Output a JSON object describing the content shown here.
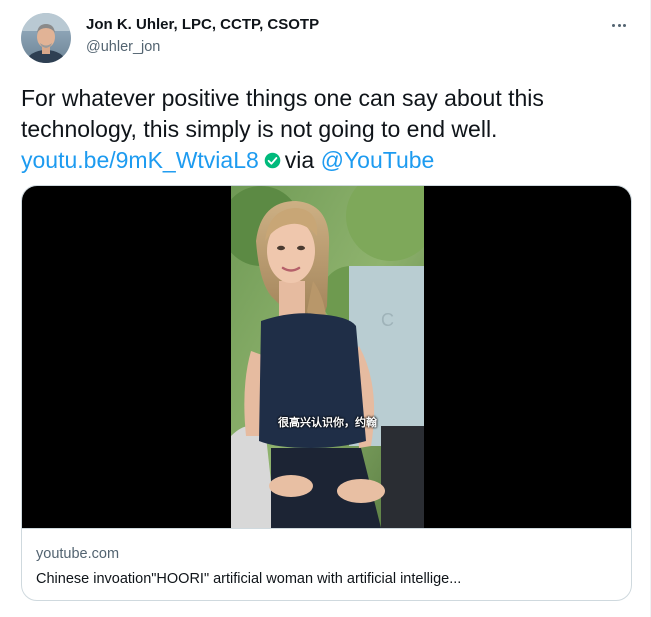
{
  "author": {
    "name": "Jon K. Uhler, LPC, CCTP, CSOTP",
    "handle": "@uhler_jon",
    "avatar_icon": "person-avatar"
  },
  "more_icon": "more-dots-icon",
  "tweet": {
    "line1": "For whatever positive things one can say about this",
    "line2": "technology, this simply is not going to end well.",
    "link_text": "youtu.be/9mK_WtviaL8",
    "via_text": "via",
    "mention": "@YouTube"
  },
  "card": {
    "domain": "youtube.com",
    "title": "Chinese invoation\"HOORI\" artificial woman with artificial intellige...",
    "video_subtitle": "很高兴认识你，约翰"
  },
  "colors": {
    "link": "#1d9bf0",
    "text": "#0f1419",
    "secondary": "#536471",
    "border": "#cfd9de",
    "verified_badge": "#00ba7c"
  }
}
